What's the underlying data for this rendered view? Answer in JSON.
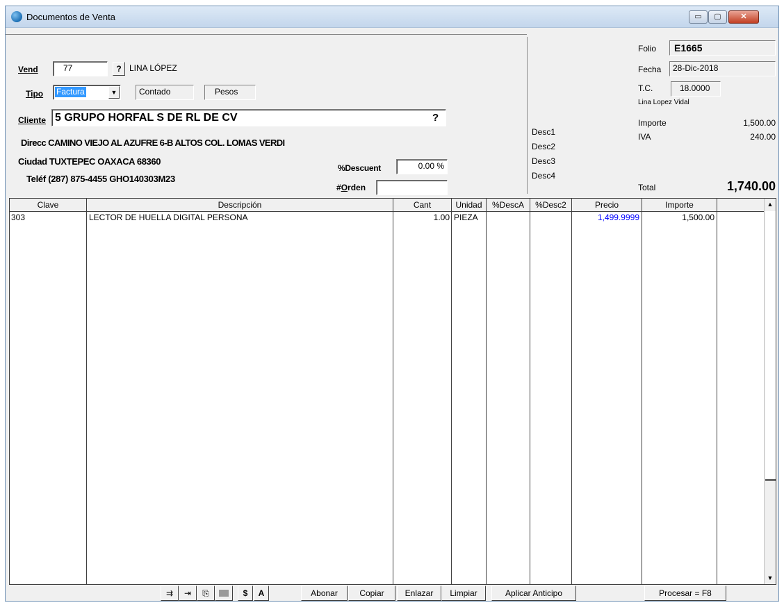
{
  "window": {
    "title": "Documentos de Venta",
    "min_glyph": "▭",
    "max_glyph": "▢",
    "close_glyph": "✕"
  },
  "header": {
    "vend_label": "Vend",
    "vend_value": "77",
    "lookup_glyph": "?",
    "vend_name": "LINA LÓPEZ",
    "tipo_label": "Tipo",
    "tipo_value": "Factura",
    "tipo_arrow": "▼",
    "payment_value": "Contado",
    "currency_value": "Pesos",
    "cliente_label": "Cliente",
    "cliente_value": "5 GRUPO HORFAL S DE RL DE CV",
    "direcc_label": "Direcc",
    "direcc_value": "CAMINO VIEJO AL AZUFRE 6-B ALTOS COL. LOMAS VERDI",
    "ciudad_label": "Ciudad",
    "ciudad_value": "TUXTEPEC OAXACA 68360",
    "telef_label": "Teléf",
    "telef_value": "(287) 875-4455 GHO140303M23",
    "descuento_label": "%Descuent",
    "descuento_value": "0.00 %",
    "orden_label": "#Orden",
    "orden_value": ""
  },
  "discounts": [
    "Desc1",
    "Desc2",
    "Desc3",
    "Desc4"
  ],
  "doc": {
    "folio_label": "Folio",
    "folio_value": "E1665",
    "fecha_label": "Fecha",
    "fecha_value": "28-Dic-2018",
    "tc_label": "T.C.",
    "tc_value": "18.0000",
    "user_name": "Lina Lopez Vidal",
    "importe_label": "Importe",
    "importe_value": "1,500.00",
    "iva_label": "IVA",
    "iva_value": "240.00",
    "total_label": "Total",
    "total_value": "1,740.00"
  },
  "grid": {
    "columns": [
      "Clave",
      "Descripción",
      "Cant",
      "Unidad",
      "%DescA",
      "%Desc2",
      "Precio",
      "Importe"
    ],
    "rows": [
      {
        "clave": "303",
        "descripcion": "LECTOR DE HUELLA DIGITAL PERSONA",
        "cant": "1.00",
        "unidad": "PIEZA",
        "desca": "",
        "desc2": "",
        "precio": "1,499.9999",
        "importe": "1,500.00"
      }
    ],
    "scroll_up": "▲",
    "scroll_down": "▼"
  },
  "toolbar": {
    "icon1": "⇉",
    "icon2": "⇥",
    "icon3": "⎘",
    "dollar_label": "$",
    "a_label": "A",
    "abonar_label": "Abonar",
    "copiar_label": "Copiar",
    "enlazar_label": "Enlazar",
    "limpiar_label": "Limpiar",
    "anticipo_label": "Aplicar Anticipo",
    "procesar_label": "Procesar = F8"
  },
  "colors": {
    "selection": "#3399ff",
    "price_blue": "#0000ff"
  }
}
